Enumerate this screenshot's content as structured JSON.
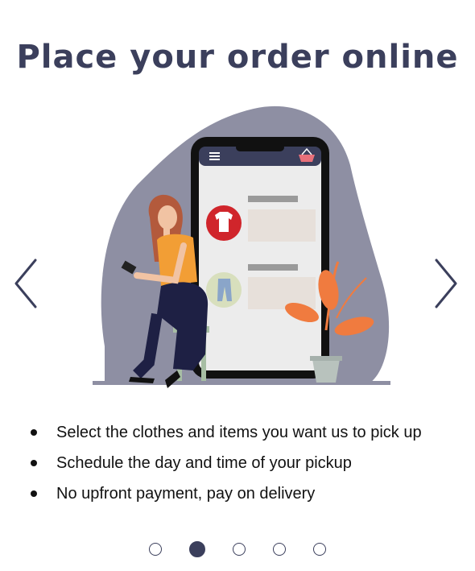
{
  "title": "Place your order online",
  "colors": {
    "title": "#3b3f5c",
    "blob": "#8e8fa3",
    "accent_red": "#d0252b",
    "plant": "#f07b3f",
    "phone": "#111111",
    "active_dot": "#3b3f5c"
  },
  "icons": {
    "prev": "chevron-left-icon",
    "next": "chevron-right-icon",
    "menu": "hamburger-menu-icon",
    "basket": "basket-icon",
    "shirt": "tshirt-icon",
    "pants": "jeans-icon"
  },
  "bullets": [
    "Select the clothes and items you want us to pick up",
    "Schedule the day and time of your pickup",
    "No upfront payment, pay on delivery"
  ],
  "pager": {
    "total": 5,
    "active_index": 1
  }
}
